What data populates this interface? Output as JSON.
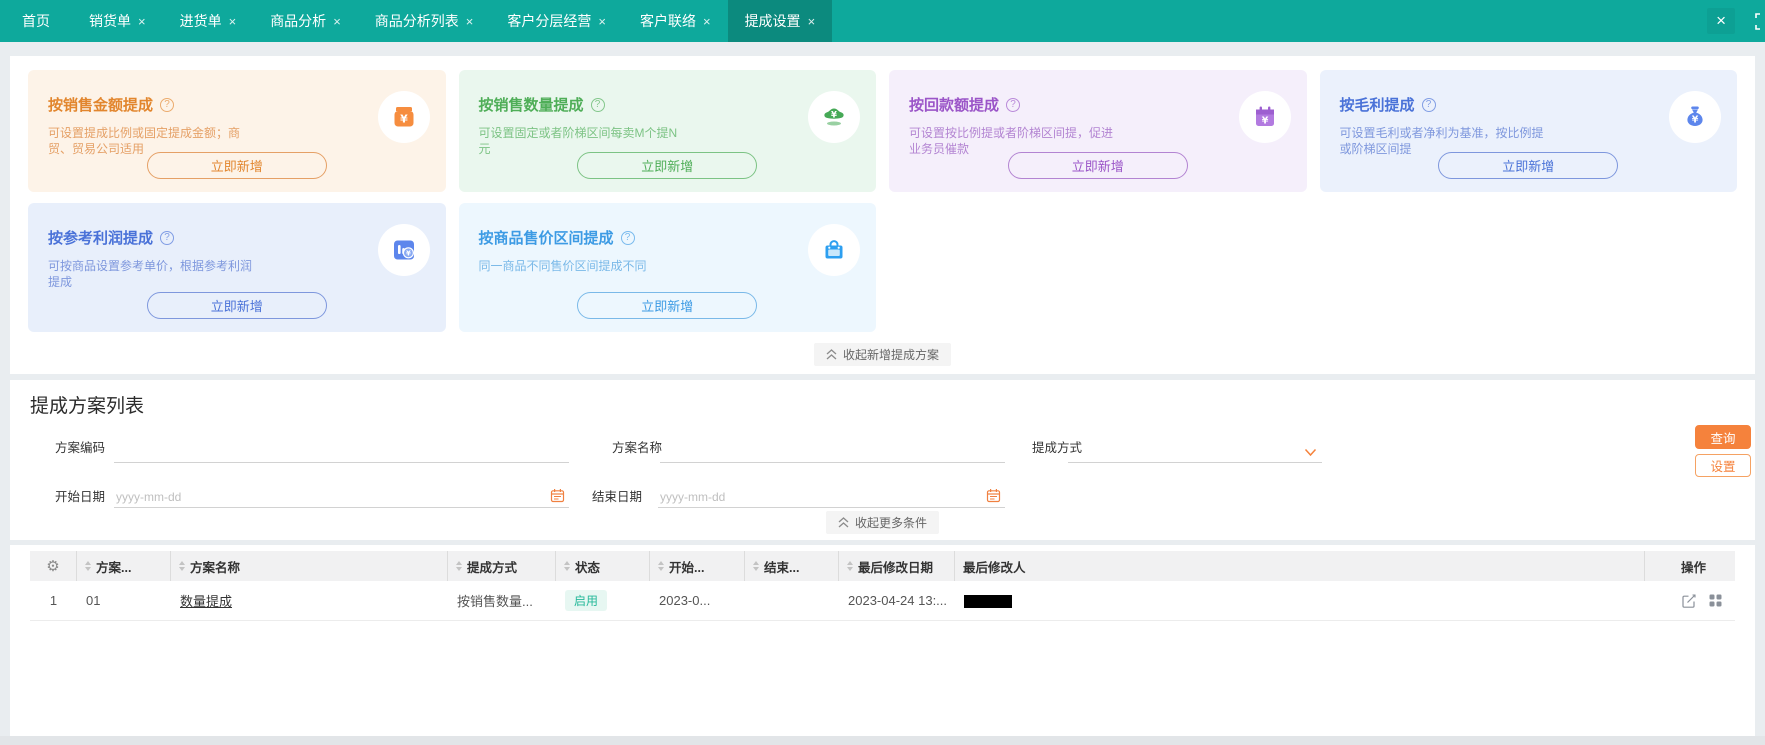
{
  "ui": {
    "help_glyph": "?",
    "tab_close_glyph": "×",
    "window_close_glyph": "×",
    "gear_glyph": "⚙",
    "brand_color": "#0ea99c",
    "active_tab_color": "#0c8a7e",
    "action_orange": "#f5823c"
  },
  "nav": {
    "tabs": [
      {
        "label": "首页",
        "closable": false,
        "active": false
      },
      {
        "label": "销货单",
        "closable": true,
        "active": false
      },
      {
        "label": "进货单",
        "closable": true,
        "active": false
      },
      {
        "label": "商品分析",
        "closable": true,
        "active": false
      },
      {
        "label": "商品分析列表",
        "closable": true,
        "active": false
      },
      {
        "label": "客户分层经营",
        "closable": true,
        "active": false
      },
      {
        "label": "客户联络",
        "closable": true,
        "active": false
      },
      {
        "label": "提成设置",
        "closable": true,
        "active": true
      }
    ]
  },
  "cards": [
    {
      "title": "按销售金额提成",
      "desc": "可设置提成比例或固定提成金额；商贸、贸易公司适用",
      "button": "立即新增",
      "icon": "money-pouch",
      "accent": "#e2862e",
      "bg": "#fdf3e8"
    },
    {
      "title": "按销售数量提成",
      "desc": "可设置固定或者阶梯区间每卖M个提N元",
      "button": "立即新增",
      "icon": "gold-ingot",
      "accent": "#4fae58",
      "bg": "#eaf7ee"
    },
    {
      "title": "按回款额提成",
      "desc": "可设置按比例提或者阶梯区间提，促进业务员催款",
      "button": "立即新增",
      "icon": "calendar-yuan",
      "accent": "#9b55c8",
      "bg": "#f5effb"
    },
    {
      "title": "按毛利提成",
      "desc": "可设置毛利或者净利为基准，按比例提或阶梯区间提",
      "button": "立即新增",
      "icon": "money-bag",
      "accent": "#4a72d8",
      "bg": "#ebf1fc"
    },
    {
      "title": "按参考利润提成",
      "desc": "可按商品设置参考单价，根据参考利润提成",
      "button": "立即新增",
      "icon": "chart-coin",
      "accent": "#4a72d8",
      "bg": "#e8effb"
    },
    {
      "title": "按商品售价区间提成",
      "desc": "同一商品不同售价区间提成不同",
      "button": "立即新增",
      "icon": "handbag",
      "accent": "#3d9be4",
      "bg": "#edf7fe"
    }
  ],
  "sections": {
    "cards_collapse_label": "收起新增提成方案",
    "list": {
      "title": "提成方案列表",
      "collapse_label": "收起更多条件",
      "filters": {
        "scheme_code_label": "方案编码",
        "scheme_name_label": "方案名称",
        "method_label": "提成方式",
        "start_date_label": "开始日期",
        "end_date_label": "结束日期",
        "date_placeholder": "yyyy-mm-dd"
      },
      "buttons": {
        "query": "查询",
        "settings": "设置"
      }
    }
  },
  "table": {
    "columns": [
      {
        "label": "",
        "icon": "gear",
        "sortable": false
      },
      {
        "label": "方案...",
        "sortable": true
      },
      {
        "label": "方案名称",
        "sortable": true
      },
      {
        "label": "提成方式",
        "sortable": true
      },
      {
        "label": "状态",
        "sortable": true
      },
      {
        "label": "开始...",
        "sortable": true
      },
      {
        "label": "结束...",
        "sortable": true
      },
      {
        "label": "最后修改日期",
        "sortable": true
      },
      {
        "label": "最后修改人",
        "sortable": false
      },
      {
        "label": "操作",
        "sortable": false
      }
    ],
    "rows": [
      {
        "index": "1",
        "code": "01",
        "name": "数量提成",
        "method": "按销售数量...",
        "status": "启用",
        "status_colors": {
          "text": "#26b99a",
          "bg": "#e7f7f2"
        },
        "start": "2023-0...",
        "end": "",
        "modified_at": "2023-04-24 13:...",
        "modified_by_masked": true
      }
    ]
  }
}
